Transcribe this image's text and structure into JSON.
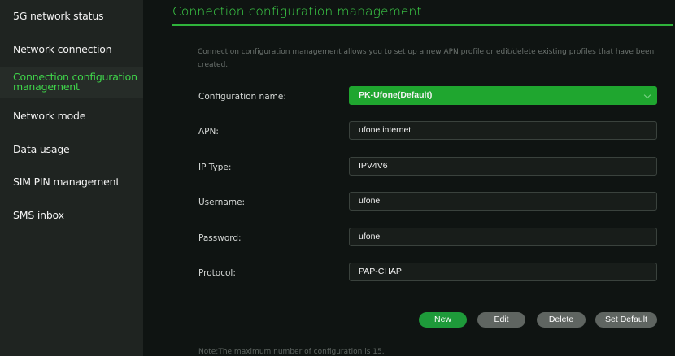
{
  "sidebar": {
    "items": [
      {
        "label": "5G network status"
      },
      {
        "label": "Network connection"
      },
      {
        "label": "Connection configuration management",
        "active": true
      },
      {
        "label": "Network mode"
      },
      {
        "label": "Data usage"
      },
      {
        "label": "SIM PIN management"
      },
      {
        "label": "SMS inbox"
      }
    ]
  },
  "main": {
    "title": "Connection configuration management",
    "description": "Connection configuration management allows you to set up a new APN profile or edit/delete existing profiles that have been created.",
    "form": {
      "configuration_name": {
        "label": "Configuration name:",
        "value": "PK-Ufone(Default)"
      },
      "apn": {
        "label": "APN:",
        "value": "ufone.internet"
      },
      "ip_type": {
        "label": "IP Type:",
        "value": "IPV4V6"
      },
      "username": {
        "label": "Username:",
        "value": "ufone"
      },
      "password": {
        "label": "Password:",
        "value": "ufone"
      },
      "protocol": {
        "label": "Protocol:",
        "value": "PAP-CHAP"
      }
    },
    "buttons": {
      "new": "New",
      "edit": "Edit",
      "delete": "Delete",
      "set_default": "Set Default"
    },
    "note": "Note:The maximum number of configuration is 15."
  },
  "colors": {
    "accent": "#3fd54a",
    "primary_button": "#1e9a3a",
    "secondary_button": "#5f6561",
    "sidebar_bg": "#1f2421",
    "main_bg": "#0f1412"
  }
}
